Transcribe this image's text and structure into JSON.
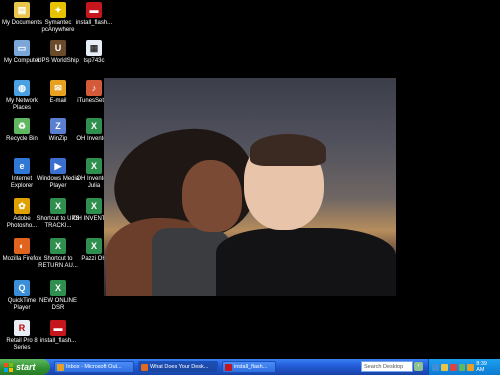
{
  "desktop": {
    "icons": [
      {
        "name": "my-documents-icon",
        "label": "My Documents",
        "color": "#e8c44a",
        "glyph": "▤"
      },
      {
        "name": "symantec-pcanywhere-icon",
        "label": "Symantec pcAnywhere",
        "color": "#e6c200",
        "glyph": "✦"
      },
      {
        "name": "install-flash-icon",
        "label": "install_flash...",
        "color": "#c4161c",
        "glyph": "▬"
      },
      {
        "name": "my-computer-icon",
        "label": "My Computer",
        "color": "#7aa7d8",
        "glyph": "▭"
      },
      {
        "name": "ups-worldship-icon",
        "label": "UPS WorldShip",
        "color": "#6b4a2a",
        "glyph": "U"
      },
      {
        "name": "tsp743c-icon",
        "label": "tsp743c",
        "color": "#e8eef5",
        "glyph": "▦"
      },
      {
        "name": "my-network-places-icon",
        "label": "My Network Places",
        "color": "#4aa0e0",
        "glyph": "◍"
      },
      {
        "name": "email-icon",
        "label": "E-mail",
        "color": "#e8a020",
        "glyph": "✉"
      },
      {
        "name": "itunessetup-icon",
        "label": "iTunesSetup",
        "color": "#d45b3a",
        "glyph": "♪"
      },
      {
        "name": "recycle-bin-icon",
        "label": "Recycle Bin",
        "color": "#5fb85f",
        "glyph": "♻"
      },
      {
        "name": "winzip-icon",
        "label": "WinZip",
        "color": "#5a7fd0",
        "glyph": "Z"
      },
      {
        "name": "oh-inventory-icon",
        "label": "OH Inventory",
        "color": "#2f8f4e",
        "glyph": "X"
      },
      {
        "name": "internet-explorer-icon",
        "label": "Internet Explorer",
        "color": "#2f78d8",
        "glyph": "e"
      },
      {
        "name": "windows-media-player-icon",
        "label": "Windows Media Player",
        "color": "#3a6fd0",
        "glyph": "▶"
      },
      {
        "name": "oh-inventory-julia-icon",
        "label": "OH Inventory Julia",
        "color": "#2f8f4e",
        "glyph": "X"
      },
      {
        "name": "adobe-photoshop-icon",
        "label": "Adobe Photosho...",
        "color": "#e0a000",
        "glyph": "✿"
      },
      {
        "name": "shortcut-ups-tracking-icon",
        "label": "Shortcut to UPS TRACKI...",
        "color": "#2f8f4e",
        "glyph": "X"
      },
      {
        "name": "oh-invento-icon",
        "label": "OH INVENTO...",
        "color": "#2f8f4e",
        "glyph": "X"
      },
      {
        "name": "mozilla-firefox-icon",
        "label": "Mozilla Firefox",
        "color": "#e0641e",
        "glyph": "◐"
      },
      {
        "name": "shortcut-return-au-icon",
        "label": "Shortcut to RETURN AU...",
        "color": "#2f8f4e",
        "glyph": "X"
      },
      {
        "name": "pazzi-oh-icon",
        "label": "Pazzi OH",
        "color": "#2f8f4e",
        "glyph": "X"
      },
      {
        "name": "quicktime-player-icon",
        "label": "QuickTime Player",
        "color": "#3a8fd8",
        "glyph": "Q"
      },
      {
        "name": "new-online-dsr-icon",
        "label": "NEW ONLINE DSR",
        "color": "#2f8f4e",
        "glyph": "X"
      },
      {
        "name": "retail-pro-icon",
        "label": "Retail Pro 8 Series",
        "color": "#e8eef5",
        "glyph": "R"
      },
      {
        "name": "install-flash-2-icon",
        "label": "install_flash...",
        "color": "#c4161c",
        "glyph": "▬"
      }
    ]
  },
  "taskbar": {
    "start_label": "start",
    "items": [
      {
        "name": "task-inbox-outlook",
        "label": "Inbox - Microsoft Out...",
        "icon_color": "#e8a020",
        "active": false
      },
      {
        "name": "task-what-does-your-desk",
        "label": "What Does Your Desk...",
        "icon_color": "#e06a1e",
        "active": true
      },
      {
        "name": "task-install-flash",
        "label": "install_flash...",
        "icon_color": "#c4161c",
        "active": false
      }
    ],
    "search_placeholder": "Search Desktop",
    "clock": "8:39 AM",
    "tray_icons": [
      "network-icon",
      "speaker-icon",
      "security-icon",
      "messenger-icon",
      "antivirus-icon"
    ]
  },
  "photo": {
    "name": "desktop-wallpaper-photo"
  }
}
